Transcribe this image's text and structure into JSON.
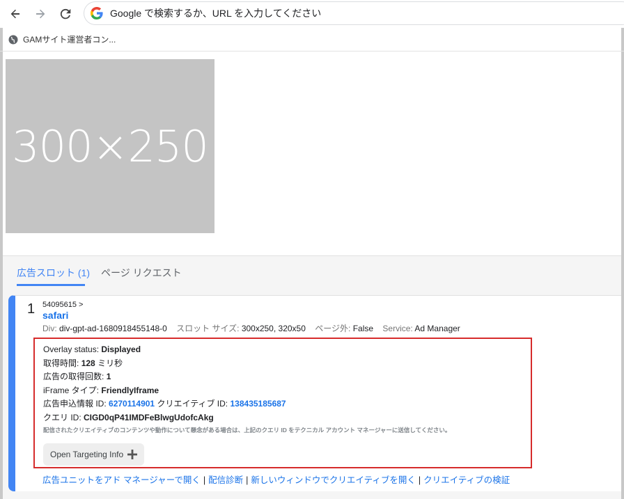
{
  "browser": {
    "omnibox_placeholder": "Google で検索するか、URL を入力してください",
    "bookmark_label": "GAMサイト運営者コン..."
  },
  "ad": {
    "placeholder_text": "300×250"
  },
  "console": {
    "tabs": [
      {
        "label": "広告スロット (1)",
        "active": true
      },
      {
        "label": "ページ リクエスト",
        "active": false
      }
    ],
    "slot": {
      "number": "1",
      "path": "54095615 >",
      "name": "safari",
      "meta": {
        "div_label": "Div:",
        "div_value": "div-gpt-ad-1680918455148-0",
        "size_label": "スロット サイズ:",
        "size_value": "300x250, 320x50",
        "outside_label": "ページ外:",
        "outside_value": "False",
        "service_label": "Service:",
        "service_value": "Ad Manager"
      },
      "details": {
        "overlay_label": "Overlay status:",
        "overlay_value": "Displayed",
        "fetch_time_label": "取得時間:",
        "fetch_time_value": "128",
        "fetch_time_unit": "ミリ秒",
        "fetch_count_label": "広告の取得回数:",
        "fetch_count_value": "1",
        "iframe_label": "iFrame タイプ:",
        "iframe_value": "FriendlyIframe",
        "lineitem_label": "広告申込情報 ID:",
        "lineitem_value": "6270114901",
        "creative_label": "クリエイティブ ID:",
        "creative_value": "138435185687",
        "query_label": "クエリ ID:",
        "query_value": "CIGD0qP41IMDFeBlwgUdofcAkg",
        "note": "配信されたクリエイティブのコンテンツや動作について懸念がある場合は、上記のクエリ ID をテクニカル アカウント マネージャーに送信してください。",
        "targeting_button": "Open Targeting Info"
      },
      "links": [
        "広告ユニットをアド マネージャーで開く",
        "配信診断",
        "新しいウィンドウでクリエイティブを開く",
        "クリエイティブの検証"
      ],
      "link_separator": "|"
    }
  },
  "colors": {
    "accent": "#4285f4",
    "link": "#1a73e8",
    "highlight_border": "#d62b2b",
    "ad_placeholder": "#c4c4c4"
  }
}
